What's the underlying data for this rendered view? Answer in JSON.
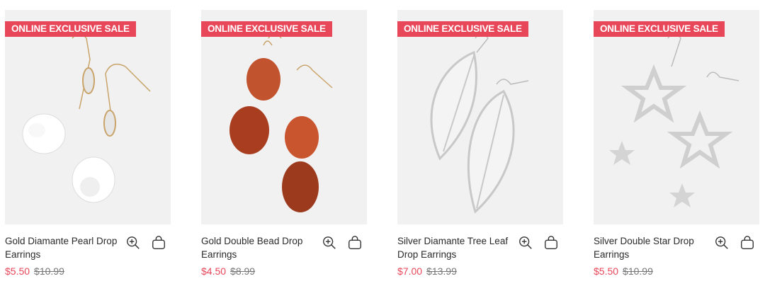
{
  "products": [
    {
      "badge": "ONLINE EXCLUSIVE SALE",
      "name": "Gold Diamante Pearl Drop Earrings",
      "sale_price": "$5.50",
      "original_price": "$10.99"
    },
    {
      "badge": "ONLINE EXCLUSIVE SALE",
      "name": "Gold Double Bead Drop Earrings",
      "sale_price": "$4.50",
      "original_price": "$8.99"
    },
    {
      "badge": "ONLINE EXCLUSIVE SALE",
      "name": "Silver Diamante Tree Leaf Drop Earrings",
      "sale_price": "$7.00",
      "original_price": "$13.99"
    },
    {
      "badge": "ONLINE EXCLUSIVE SALE",
      "name": "Silver Double Star Drop Earrings",
      "sale_price": "$5.50",
      "original_price": "$10.99"
    }
  ],
  "icons": {
    "quick_view": "zoom-in-icon",
    "add_to_bag": "shopping-bag-icon"
  },
  "colors": {
    "accent": "#e8475a",
    "strike": "#777777",
    "image_bg": "#f2f1f1"
  }
}
